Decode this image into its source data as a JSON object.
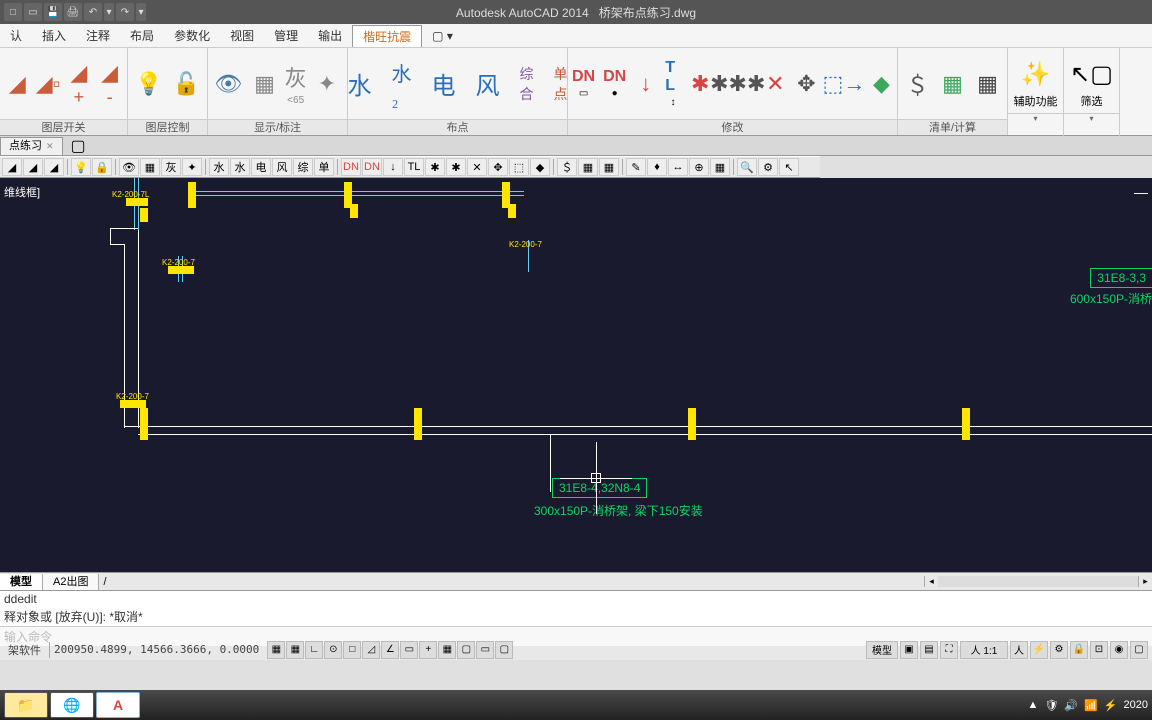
{
  "title": {
    "app": "Autodesk AutoCAD 2014",
    "file": "桥架布点练习.dwg"
  },
  "qat_icons": [
    "new",
    "open",
    "save",
    "print",
    "undo",
    "dropdown",
    "redo",
    "dropdown"
  ],
  "menu": {
    "items": [
      "认",
      "插入",
      "注释",
      "布局",
      "参数化",
      "视图",
      "管理",
      "输出",
      "楷旺抗震"
    ],
    "active_index": 8
  },
  "ribbon": {
    "panels": [
      {
        "title": "图层开关",
        "items": [
          "layer1",
          "layer2",
          "layer3",
          "layer4"
        ]
      },
      {
        "title": "图层控制",
        "items": [
          "bulb",
          "lock",
          "eye",
          "grid"
        ]
      },
      {
        "title": "显示/标注",
        "gray_label": "灰",
        "gray_sub": "<65",
        "items": [
          "gray",
          "burst"
        ]
      },
      {
        "title": "布点",
        "chars": [
          "水",
          "水₂",
          "电",
          "风",
          "综合",
          "单点"
        ]
      },
      {
        "title": "修改",
        "items": [
          "DN1",
          "DN2",
          "arrow",
          "TL",
          "asterisk",
          "stars",
          "x-cross",
          "move-4way",
          "rect-arrow",
          "diamond-green"
        ]
      },
      {
        "title": "清单/计算",
        "items": [
          "dollar",
          "table-green",
          "calc"
        ]
      }
    ],
    "aux_label": "辅助功能",
    "filter_label": "筛选"
  },
  "file_tabs": {
    "active": "点练习",
    "plus": "+"
  },
  "canvas": {
    "frame_label": "维线框]",
    "labels_yellow": [
      "K2-200-7",
      "K2-200-7L",
      "K2-200-7",
      "K2-200-7",
      "K2-200-7"
    ],
    "green_box_line1": "31E8-4,32N8-4",
    "green_box_line2": "300x150P-消桥架, 梁下150安装",
    "green_right_line1": "31E8-3,3",
    "green_right_line2": "600x150P-消桥"
  },
  "layout_tabs": {
    "items": [
      "模型",
      "A2出图"
    ],
    "active": 0
  },
  "command": {
    "line1": "ddedit",
    "line2": "释对象或 [放弃(U)]: *取消*",
    "prompt": "输入命令"
  },
  "status": {
    "label": "架软件",
    "coords": "200950.4899, 14566.3666,  0.0000",
    "mode_label": "模型",
    "scale": "人 1:1",
    "year": "2020"
  },
  "taskbar": {
    "items": [
      "explorer",
      "browser",
      "autocad"
    ],
    "tray_icons": [
      "▲",
      "🛡",
      "🔊",
      "📶",
      "⚡"
    ]
  }
}
